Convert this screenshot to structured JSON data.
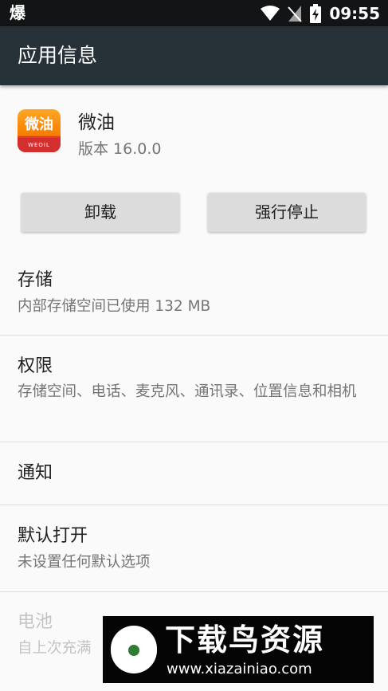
{
  "status_bar": {
    "left_text": "爆",
    "time": "09:55",
    "icons": [
      "wifi-icon",
      "no-sim-icon",
      "battery-charging-icon"
    ]
  },
  "app_bar": {
    "title": "应用信息"
  },
  "app": {
    "name": "微油",
    "version": "版本 16.0.0",
    "icon_text": "微油",
    "icon_subtext": "WEOIL"
  },
  "buttons": {
    "uninstall": "卸载",
    "force_stop": "强行停止"
  },
  "items": [
    {
      "title": "存储",
      "summary": "内部存储空间已使用 132 MB"
    },
    {
      "title": "权限",
      "summary": "存储空间、电话、麦克风、通讯录、位置信息和相机"
    },
    {
      "title": "通知",
      "summary": ""
    },
    {
      "title": "默认打开",
      "summary": "未设置任何默认选项"
    },
    {
      "title": "电池",
      "summary": "自上次充满"
    }
  ],
  "watermark": {
    "title": "下载鸟资源",
    "url": "www.xiazainiao.com"
  },
  "colors": {
    "status_bar": "#121416",
    "app_bar": "#263238",
    "background": "#fafafa",
    "button": "#dcdcdc"
  }
}
